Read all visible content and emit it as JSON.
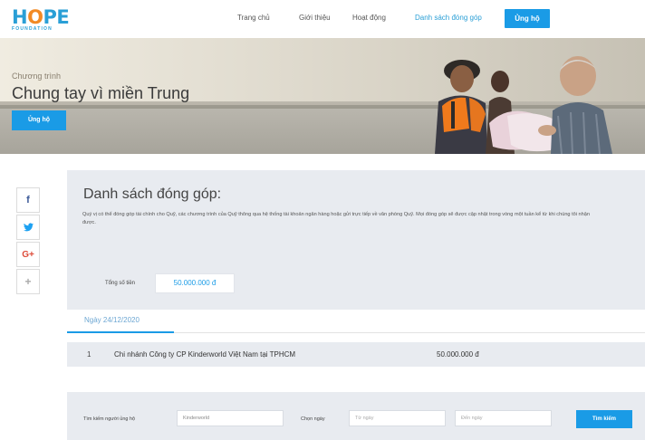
{
  "header": {
    "logo": {
      "main_h": "H",
      "main_o": "O",
      "main_pe": "PE",
      "sub": "FOUNDATION"
    },
    "nav": [
      {
        "label": "Trang chủ"
      },
      {
        "label": "Giới thiệu"
      },
      {
        "label": "Hoạt động"
      },
      {
        "label": "Danh sách đóng góp"
      }
    ],
    "register_label": "Ủng hộ"
  },
  "banner": {
    "kicker": "Chương trình",
    "title": "Chung tay vì miền Trung",
    "button_label": "Ủng hộ"
  },
  "social": [
    {
      "icon": "facebook-icon",
      "glyph": "f"
    },
    {
      "icon": "twitter-icon",
      "glyph": "🐦"
    },
    {
      "icon": "google-plus-icon",
      "glyph": "G+"
    },
    {
      "icon": "plus-icon",
      "glyph": "+"
    }
  ],
  "panel": {
    "title": "Danh sách đóng góp:",
    "description": "Quý vị có thể đóng góp tài chính cho Quỹ, các chương trình của Quỹ thông qua hệ thống tài khoản ngân hàng hoặc gửi trực tiếp về văn phòng Quỹ. Mọi đóng góp sẽ được cập nhật trong vòng một tuần kể từ khi chúng tôi nhận được.",
    "total_label": "Tổng số tiền",
    "total_value": "50.000.000 đ"
  },
  "date_tab": "Ngày 24/12/2020",
  "rows": [
    {
      "index": "1",
      "name": "Chi nhánh Công ty CP Kinderworld Việt Nam tại TPHCM",
      "amount": "50.000.000 đ"
    }
  ],
  "search": {
    "name_label": "Tìm kiếm người ủng hộ",
    "name_value": "Kinderworld",
    "date_label": "Chọn ngày",
    "from_placeholder": "Từ ngày",
    "to_placeholder": "Đến ngày",
    "button_label": "Tìm kiếm"
  },
  "colors": {
    "accent": "#1a9be6",
    "panel_bg": "#e8ebf0"
  }
}
